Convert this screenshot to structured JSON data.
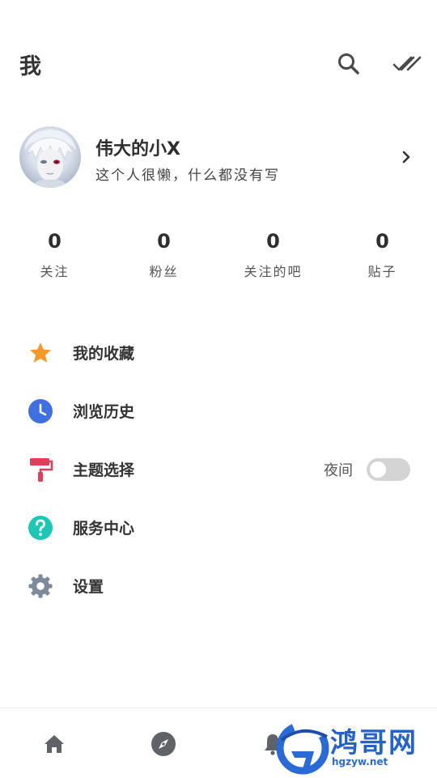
{
  "header": {
    "title": "我",
    "icons": [
      "search-icon",
      "done-all-icon"
    ]
  },
  "profile": {
    "name": "伟大的小X",
    "bio": "这个人很懒，什么都没有写"
  },
  "stats": [
    {
      "value": "0",
      "label": "关注"
    },
    {
      "value": "0",
      "label": "粉丝"
    },
    {
      "value": "0",
      "label": "关注的吧"
    },
    {
      "value": "0",
      "label": "贴子"
    }
  ],
  "menu": {
    "items": [
      {
        "label": "我的收藏",
        "icon": "star-icon",
        "color": "#F39A2B"
      },
      {
        "label": "浏览历史",
        "icon": "clock-icon",
        "color": "#3F6FE0"
      },
      {
        "label": "主题选择",
        "icon": "paint-roller-icon",
        "color": "#E23D5B"
      },
      {
        "label": "服务中心",
        "icon": "help-icon",
        "color": "#1DC6B5"
      },
      {
        "label": "设置",
        "icon": "gear-icon",
        "color": "#7D8A99"
      }
    ],
    "night_mode_label": "夜间",
    "night_mode_on": false
  },
  "bottom_nav": {
    "icons": [
      "home-icon",
      "explore-icon",
      "bell-icon"
    ]
  },
  "watermark": {
    "text": "鸿哥网",
    "url": "hgzyw.net"
  },
  "colors": {
    "text_primary": "#333333",
    "icon_gray": "#5f6368",
    "toggle_off": "#d4d4d4"
  }
}
